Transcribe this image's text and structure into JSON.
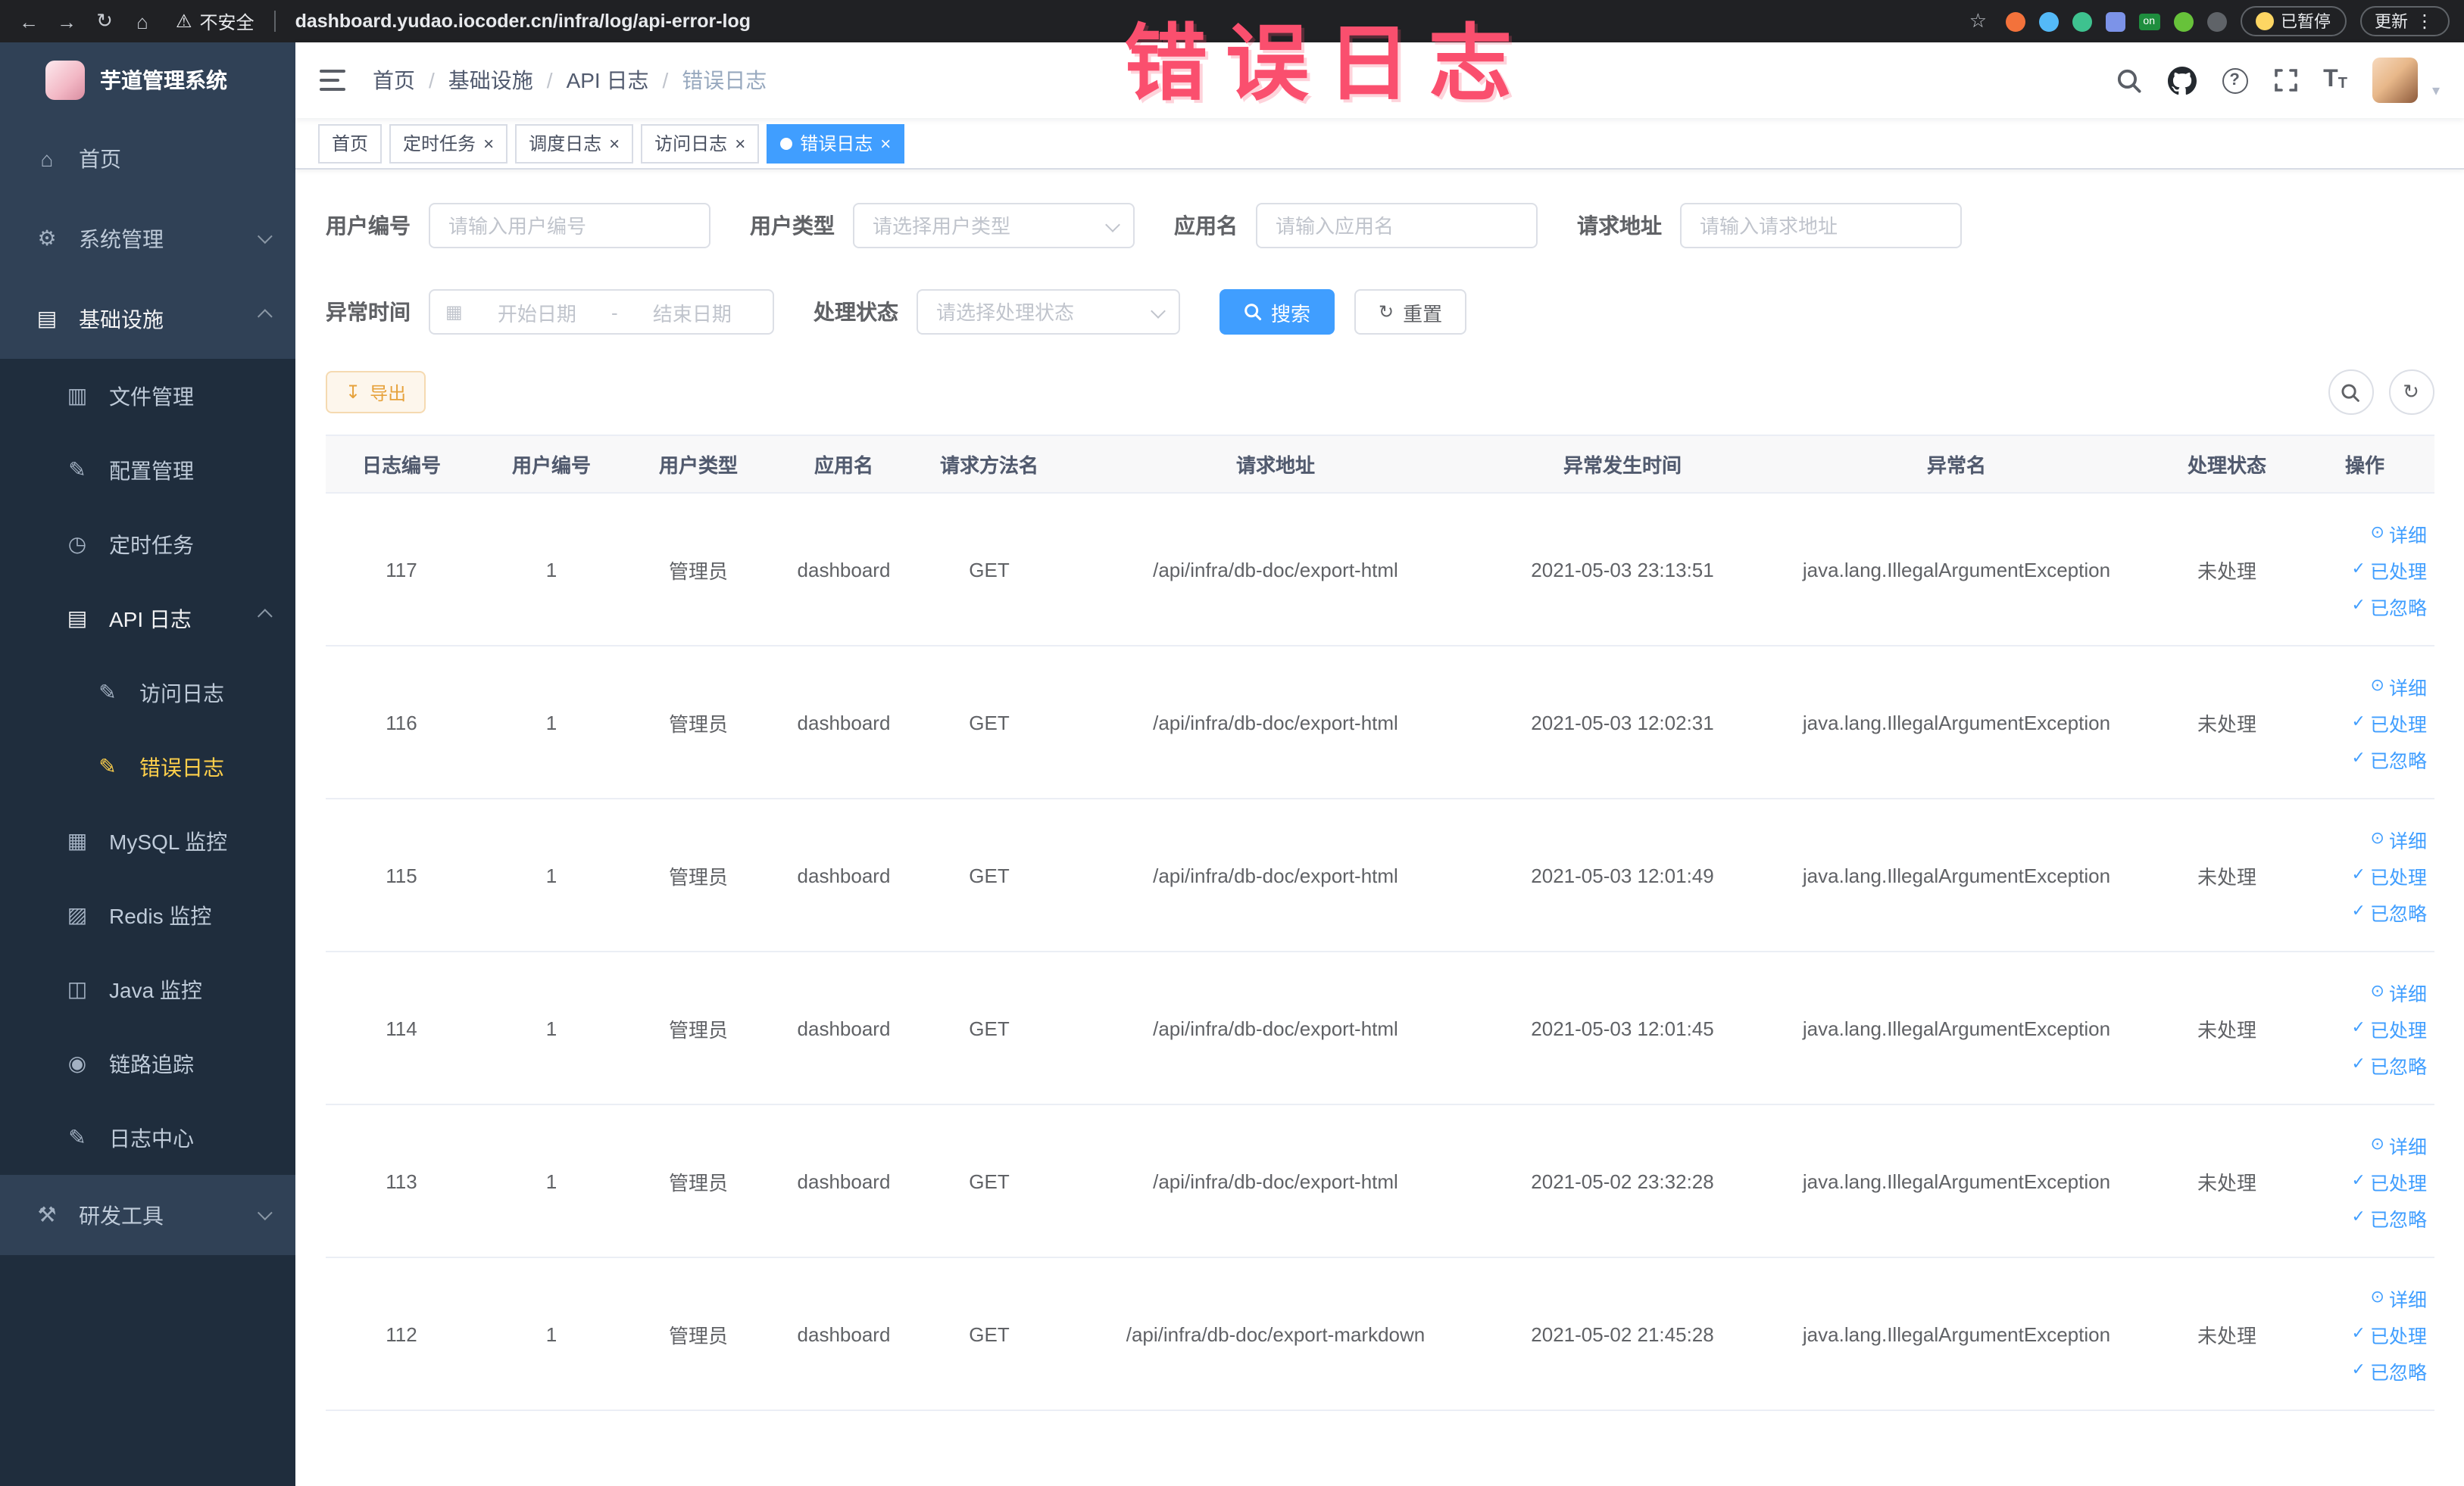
{
  "glyphs": {
    "back": "←",
    "forward": "→",
    "reload": "↻",
    "home": "⌂",
    "warning": "⚠",
    "star": "☆",
    "dots": "⋮",
    "close": "×",
    "check": "✓",
    "eye": "⊙",
    "download": "↧",
    "refresh": "↻",
    "calendar": "▦",
    "caret_down": "▾",
    "help": "?",
    "on_badge": "on",
    "font_large": "T",
    "font_small": "T",
    "menu_home": "⌂",
    "menu_system": "⚙",
    "menu_infra": "▤",
    "menu_file": "▥",
    "menu_config": "✎",
    "menu_cron": "◷",
    "menu_api": "▤",
    "menu_access": "✎",
    "menu_error": "✎",
    "menu_mysql": "▦",
    "menu_redis": "▨",
    "menu_java": "◫",
    "menu_trace": "◉",
    "menu_logcenter": "✎",
    "menu_tools": "⚒"
  },
  "browser": {
    "security_label": "不安全",
    "url": "dashboard.yudao.iocoder.cn/infra/log/api-error-log",
    "paused_label": "已暂停",
    "update_label": "更新"
  },
  "annotation": {
    "text": "错误日志"
  },
  "sidebar": {
    "logo_title": "芋道管理系统",
    "home": "首页",
    "system": "系统管理",
    "infra": "基础设施",
    "file": "文件管理",
    "config": "配置管理",
    "cron": "定时任务",
    "api_log": "API 日志",
    "access_log": "访问日志",
    "error_log": "错误日志",
    "mysql": "MySQL 监控",
    "redis": "Redis 监控",
    "java": "Java 监控",
    "trace": "链路追踪",
    "log_center": "日志中心",
    "tools": "研发工具"
  },
  "navbar": {
    "breadcrumbs": [
      "首页",
      "基础设施",
      "API 日志",
      "错误日志"
    ],
    "separator": "/"
  },
  "tabs": {
    "home": "首页",
    "cron": "定时任务",
    "job_log": "调度日志",
    "access_log": "访问日志",
    "error_log": "错误日志"
  },
  "filters": {
    "user_id_label": "用户编号",
    "user_id_placeholder": "请输入用户编号",
    "user_type_label": "用户类型",
    "user_type_placeholder": "请选择用户类型",
    "app_name_label": "应用名",
    "app_name_placeholder": "请输入应用名",
    "request_url_label": "请求地址",
    "request_url_placeholder": "请输入请求地址",
    "exception_time_label": "异常时间",
    "start_placeholder": "开始日期",
    "end_placeholder": "结束日期",
    "range_separator": "-",
    "process_status_label": "处理状态",
    "process_status_placeholder": "请选择处理状态",
    "search_label": "搜索",
    "reset_label": "重置"
  },
  "toolbar": {
    "export_label": "导出"
  },
  "table": {
    "headers": [
      "日志编号",
      "用户编号",
      "用户类型",
      "应用名",
      "请求方法名",
      "请求地址",
      "异常发生时间",
      "异常名",
      "处理状态",
      "操作"
    ],
    "actions": {
      "detail": "详细",
      "processed": "已处理",
      "ignored": "已忽略"
    },
    "rows": [
      {
        "id": "117",
        "user_id": "1",
        "user_type": "管理员",
        "app_name": "dashboard",
        "method": "GET",
        "url": "/api/infra/db-doc/export-html",
        "time": "2021-05-03 23:13:51",
        "exception": "java.lang.IllegalArgumentException",
        "status": "未处理"
      },
      {
        "id": "116",
        "user_id": "1",
        "user_type": "管理员",
        "app_name": "dashboard",
        "method": "GET",
        "url": "/api/infra/db-doc/export-html",
        "time": "2021-05-03 12:02:31",
        "exception": "java.lang.IllegalArgumentException",
        "status": "未处理"
      },
      {
        "id": "115",
        "user_id": "1",
        "user_type": "管理员",
        "app_name": "dashboard",
        "method": "GET",
        "url": "/api/infra/db-doc/export-html",
        "time": "2021-05-03 12:01:49",
        "exception": "java.lang.IllegalArgumentException",
        "status": "未处理"
      },
      {
        "id": "114",
        "user_id": "1",
        "user_type": "管理员",
        "app_name": "dashboard",
        "method": "GET",
        "url": "/api/infra/db-doc/export-html",
        "time": "2021-05-03 12:01:45",
        "exception": "java.lang.IllegalArgumentException",
        "status": "未处理"
      },
      {
        "id": "113",
        "user_id": "1",
        "user_type": "管理员",
        "app_name": "dashboard",
        "method": "GET",
        "url": "/api/infra/db-doc/export-html",
        "time": "2021-05-02 23:32:28",
        "exception": "java.lang.IllegalArgumentException",
        "status": "未处理"
      },
      {
        "id": "112",
        "user_id": "1",
        "user_type": "管理员",
        "app_name": "dashboard",
        "method": "GET",
        "url": "/api/infra/db-doc/export-markdown",
        "time": "2021-05-02 21:45:28",
        "exception": "java.lang.IllegalArgumentException",
        "status": "未处理"
      }
    ]
  }
}
